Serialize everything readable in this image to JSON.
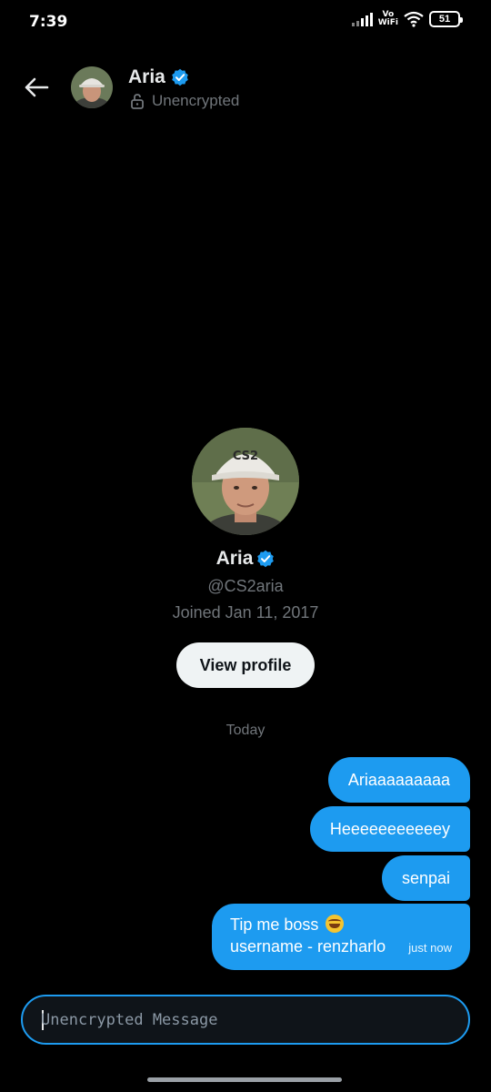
{
  "status_bar": {
    "time": "7:39",
    "network_label_top": "Vo",
    "network_label_bottom": "WiFi",
    "battery": "51"
  },
  "header": {
    "name": "Aria",
    "encryption_status": "Unencrypted",
    "verified": true
  },
  "profile": {
    "name": "Aria",
    "handle": "@CS2aria",
    "joined": "Joined Jan 11, 2017",
    "view_profile_label": "View profile",
    "cap_text": "CS2"
  },
  "conversation": {
    "date_separator": "Today",
    "messages": [
      {
        "text": "Ariaaaaaaaaa"
      },
      {
        "text": "Heeeeeeeeeeey"
      },
      {
        "text": "senpai"
      },
      {
        "line1": "Tip me boss",
        "line2": "username - renzharlo",
        "timestamp": "just now"
      }
    ]
  },
  "composer": {
    "placeholder": "Unencrypted Message"
  },
  "colors": {
    "accent": "#1d9bf0",
    "background": "#000000",
    "secondary_text": "#71767b"
  }
}
